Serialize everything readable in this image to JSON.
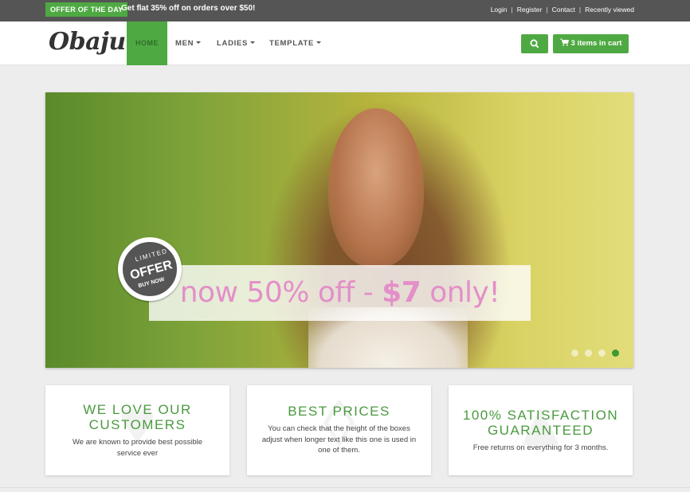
{
  "topbar": {
    "offer_badge": "OFFER OF THE DAY",
    "offer_text": "Get flat 35% off on orders over $50!",
    "links": [
      "Login",
      "Register",
      "Contact",
      "Recently viewed"
    ]
  },
  "navbar": {
    "logo": "Obaju",
    "items": [
      {
        "label": "HOME"
      },
      {
        "label": "MEN"
      },
      {
        "label": "LADIES"
      },
      {
        "label": "TEMPLATE"
      }
    ],
    "search_icon": "search-icon",
    "cart_label": "3 items in cart",
    "cart_icon": "shopping-cart-icon"
  },
  "hero": {
    "promo_prefix": "now 50% off - ",
    "promo_price": "$7",
    "promo_suffix": " only!",
    "stamp": {
      "line1": "LIMITED",
      "line2": "OFFER",
      "line3": "BUY NOW"
    },
    "slides_count": 4,
    "active_slide": 4
  },
  "features": [
    {
      "title": "WE LOVE OUR CUSTOMERS",
      "desc": "We are known to provide best possible service ever",
      "icon": "heart-icon"
    },
    {
      "title": "BEST PRICES",
      "desc": "You can check that the height of the boxes adjust when longer text like this one is used in one of them.",
      "icon": "tag-icon"
    },
    {
      "title": "100% SATISFACTION GUARANTEED",
      "desc": "Free returns on everything for 3 months.",
      "icon": "thumbs-up-icon"
    }
  ],
  "colors": {
    "accent": "#4fa943",
    "topbar_bg": "#555555",
    "promo_text": "#e38fc8",
    "feature_title": "#4a9a3f"
  }
}
